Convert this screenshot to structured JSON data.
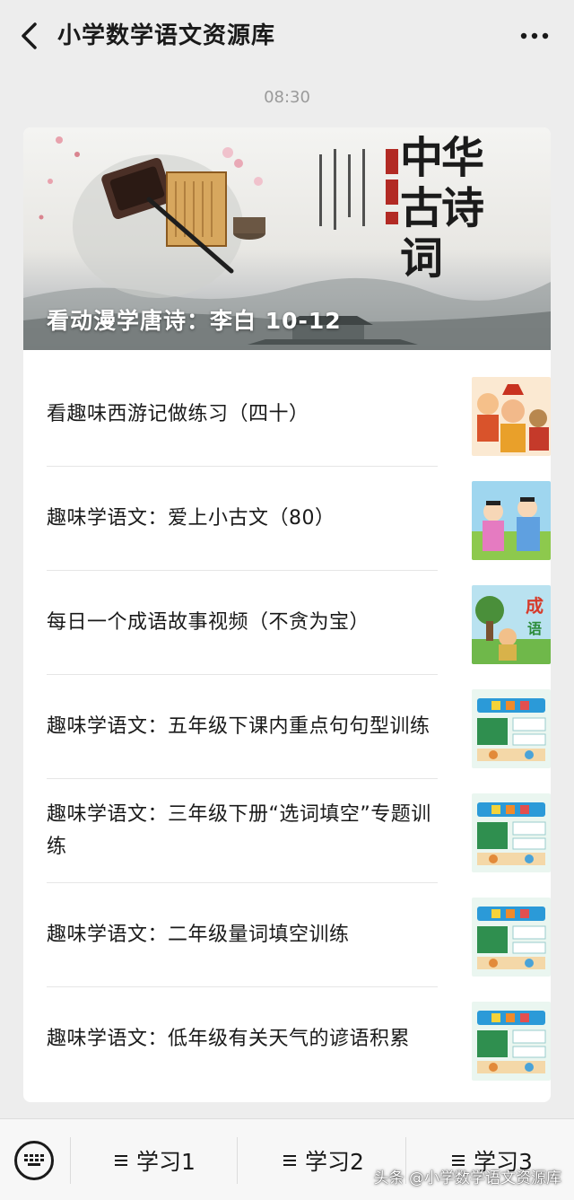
{
  "header": {
    "title": "小学数学语文资源库",
    "back_icon": "back-chevron-icon",
    "more_icon": "more-dots-icon"
  },
  "timestamp": "08:30",
  "banner": {
    "caption": "看动漫学唐诗：李白 10-12",
    "art_text": "中华古诗词"
  },
  "articles": [
    {
      "title": "看趣味西游记做练习（四十）",
      "thumb": "journey-west-characters"
    },
    {
      "title": "趣味学语文：爱上小古文（80）",
      "thumb": "ancient-scholars"
    },
    {
      "title": "每日一个成语故事视频（不贪为宝）",
      "thumb": "idiom-story"
    },
    {
      "title": "趣味学语文：五年级下课内重点句句型训练",
      "thumb": "fun-chinese-board"
    },
    {
      "title": "趣味学语文：三年级下册“选词填空”专题训练",
      "thumb": "fun-chinese-board"
    },
    {
      "title": "趣味学语文：二年级量词填空训练",
      "thumb": "fun-chinese-board"
    },
    {
      "title": "趣味学语文：低年级有关天气的谚语积累",
      "thumb": "fun-chinese-board"
    }
  ],
  "bottom_menu": {
    "keyboard_icon": "keyboard-icon",
    "items": [
      {
        "label": "学习1",
        "icon": "menu-lines-icon"
      },
      {
        "label": "学习2",
        "icon": "menu-lines-icon"
      },
      {
        "label": "学习3",
        "icon": "menu-lines-icon"
      }
    ]
  },
  "watermark": "头条 @小学数学语文资源库"
}
